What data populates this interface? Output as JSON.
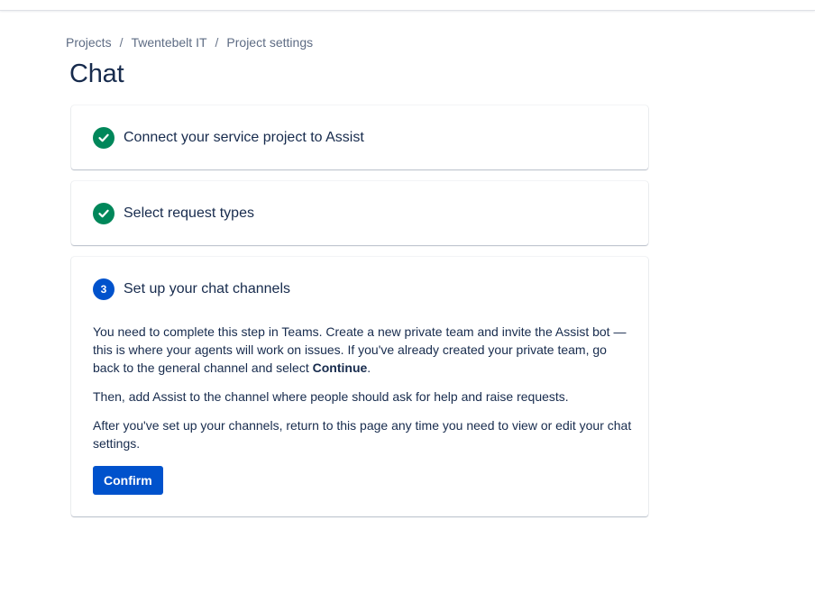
{
  "breadcrumb": {
    "items": [
      "Projects",
      "Twentebelt IT",
      "Project settings"
    ],
    "separator": "/"
  },
  "page": {
    "title": "Chat"
  },
  "steps": [
    {
      "status": "complete",
      "icon": "check-circle-icon",
      "title": "Connect your service project to Assist"
    },
    {
      "status": "complete",
      "icon": "check-circle-icon",
      "title": "Select request types"
    },
    {
      "status": "current",
      "number": "3",
      "title": "Set up your chat channels",
      "body": {
        "p1_text": "You need to complete this step in Teams. Create a new private team and invite the Assist bot — this is where your agents will work on issues. If you've already created your private team, go back to the general channel and select ",
        "p1_bold": "Continue",
        "p1_end": ".",
        "p2": "Then, add Assist to the channel where people should ask for help and raise requests.",
        "p3": "After you've set up your channels, return to this page any time you need to view or edit your chat settings."
      },
      "confirm_label": "Confirm"
    }
  ],
  "colors": {
    "success": "#00875a",
    "primary": "#0052cc",
    "text": "#172b4d",
    "subtle_text": "#5e6c84"
  }
}
